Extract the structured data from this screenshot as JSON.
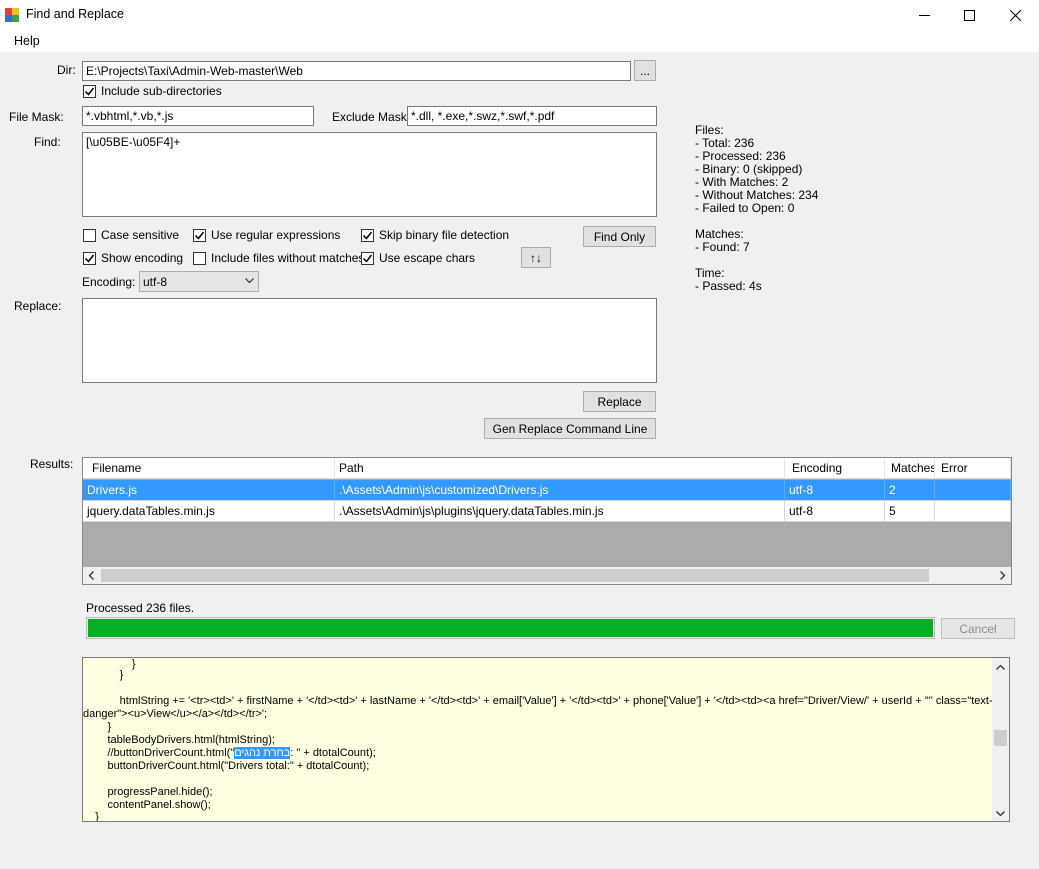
{
  "window": {
    "title": "Find and Replace",
    "minimize_glyph": "—",
    "maximize_glyph": "☐",
    "close_glyph": "✕"
  },
  "menu": {
    "help": "Help"
  },
  "dir": {
    "label": "Dir:",
    "value": "E:\\Projects\\Taxi\\Admin-Web-master\\Web",
    "browse_label": "...",
    "include_subdirs_label": "Include sub-directories",
    "include_subdirs_checked": true
  },
  "file_mask": {
    "label": "File Mask:",
    "value": "*.vbhtml,*.vb,*.js"
  },
  "exclude_mask": {
    "label": "Exclude Mask:",
    "value": "*.dll, *.exe,*.swz,*.swf,*.pdf"
  },
  "find": {
    "label": "Find:",
    "value": "[\\u05BE-\\u05F4]+"
  },
  "options": {
    "case_sensitive": {
      "label": "Case sensitive",
      "checked": false
    },
    "use_regex": {
      "label": "Use regular expressions",
      "checked": true
    },
    "skip_binary": {
      "label": "Skip binary file detection",
      "checked": true
    },
    "show_encoding": {
      "label": "Show encoding",
      "checked": true
    },
    "include_no_matches": {
      "label": "Include files without matches",
      "checked": false
    },
    "use_escape": {
      "label": "Use escape chars",
      "checked": true
    }
  },
  "buttons": {
    "find_only": "Find Only",
    "swap": "↑↓",
    "replace": "Replace",
    "gen_cmd": "Gen Replace Command Line",
    "cancel": "Cancel"
  },
  "encoding": {
    "label": "Encoding:",
    "value": "utf-8"
  },
  "replace": {
    "label": "Replace:",
    "value": ""
  },
  "stats": {
    "files_header": "Files:",
    "total": "- Total: 236",
    "processed": "- Processed: 236",
    "binary": "- Binary: 0 (skipped)",
    "with_matches": "- With Matches: 2",
    "without_matches": "- Without Matches: 234",
    "failed": "- Failed to Open: 0",
    "matches_header": "Matches:",
    "found": "- Found: 7",
    "time_header": "Time:",
    "passed": "- Passed: 4s"
  },
  "results": {
    "label": "Results:",
    "columns": [
      "Filename",
      "Path",
      "Encoding",
      "Matches",
      "Error"
    ],
    "rows": [
      [
        "Drivers.js",
        ".\\Assets\\Admin\\js\\customized\\Drivers.js",
        "utf-8",
        "2",
        ""
      ],
      [
        "jquery.dataTables.min.js",
        ".\\Assets\\Admin\\js\\plugins\\jquery.dataTables.min.js",
        "utf-8",
        "5",
        ""
      ]
    ]
  },
  "progress": {
    "status": "Processed 236 files.",
    "percent": 100,
    "color": "#06b025"
  },
  "preview": {
    "lines": [
      "                }",
      "            }",
      "",
      "            htmlString += '<tr><td>' + firstName + '</td><td>' + lastName + '</td><td>' + email['Value'] + '</td><td>' + phone['Value'] + '</td><td><a href=\"Driver/View/' + userId + '\"' class=\"text-",
      "danger\"><u>View</u></a></td></tr>';",
      "        }",
      "        tableBodyDrivers.html(htmlString);",
      "        //buttonDriverCount.html(\"",
      "        buttonDriverCount.html(\"Drivers total:\" + dtotalCount);",
      "",
      "        progressPanel.hide();",
      "        contentPanel.show();",
      "    }"
    ],
    "highlight": "בחרת נהגים",
    "line7_suffix": ": \" + dtotalCount);"
  }
}
